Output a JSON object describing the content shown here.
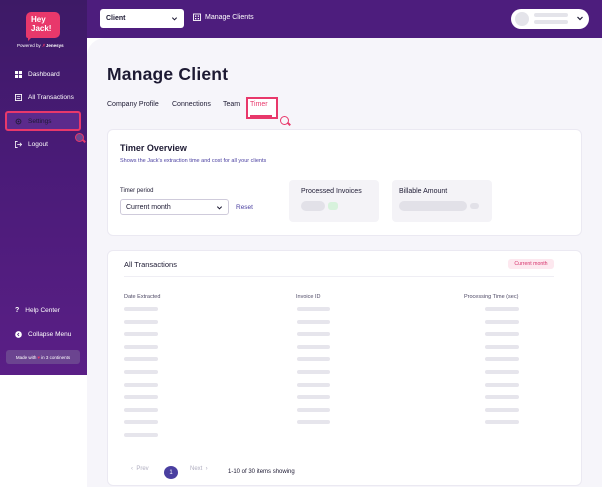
{
  "brand": {
    "logo_text": "Hey\nJack!",
    "powered_by": "Powered by",
    "powered_by_company": "Jenesys",
    "accent_color": "#e8386b",
    "sidebar_color": "#4a1b78"
  },
  "sidebar": {
    "items": [
      {
        "label": "Dashboard",
        "icon": "dashboard-icon"
      },
      {
        "label": "All Transactions",
        "icon": "transactions-icon"
      },
      {
        "label": "Settings",
        "icon": "gear-icon",
        "active": true
      },
      {
        "label": "Logout",
        "icon": "logout-icon"
      }
    ],
    "help": {
      "label": "Help Center",
      "icon": "question-icon"
    },
    "collapse": {
      "label": "Collapse Menu",
      "icon": "chevron-left-icon"
    },
    "made_with": {
      "prefix": "Made with",
      "suffix": "in  3 continents"
    }
  },
  "topbar": {
    "client_select": {
      "value": "Client"
    },
    "manage_clients": {
      "label": "Manage Clients",
      "icon": "building-icon"
    }
  },
  "page": {
    "title": "Manage Client",
    "tabs": [
      {
        "label": "Company Profile"
      },
      {
        "label": "Connections"
      },
      {
        "label": "Team"
      },
      {
        "label": "Timer",
        "active": true
      }
    ]
  },
  "overview": {
    "title": "Timer Overview",
    "subtitle": "Shows the Jack's extraction time and cost for all your clients",
    "period_label": "Timer period",
    "period_value": "Current month",
    "reset_label": "Reset",
    "processed_invoices_label": "Processed Invoices",
    "billable_amount_label": "Billable Amount"
  },
  "transactions": {
    "title": "All Transactions",
    "badge": "Current month",
    "columns": [
      "Date Extracted",
      "Invoice ID",
      "Processing Time (sec)"
    ],
    "pagination": {
      "prev": "Prev",
      "next": "Next",
      "current_page": "1",
      "showing": "1-10 of 30 items showing"
    }
  }
}
